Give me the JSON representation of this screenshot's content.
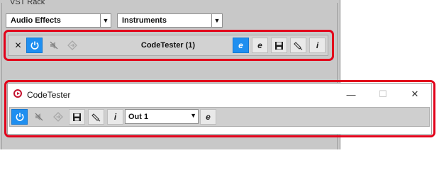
{
  "rack": {
    "title": "VST Rack",
    "dropdown_audio_effects": "Audio Effects",
    "dropdown_instruments": "Instruments",
    "dropdown_arrow": "▼",
    "slot": {
      "name": "CodeTester (1)",
      "buttons": {
        "close": "✕",
        "edit_e_bold": "e",
        "edit_e": "e",
        "info": "i"
      }
    }
  },
  "plugin_window": {
    "title": "CodeTester",
    "controls": {
      "minimize": "—",
      "maximize": "☐",
      "close": "✕"
    },
    "toolbar": {
      "info": "i",
      "output_value": "Out 1",
      "output_arrow": "▼",
      "edit_e": "e"
    }
  },
  "colors": {
    "highlight_border": "#e2001a",
    "active_blue": "#1f8ff0",
    "panel_gray": "#c8c8c8"
  },
  "icons": [
    "close-icon",
    "power-icon",
    "bypass-icon",
    "sidechain-icon",
    "save-icon",
    "preset-icon",
    "info-icon",
    "edit-icon"
  ]
}
